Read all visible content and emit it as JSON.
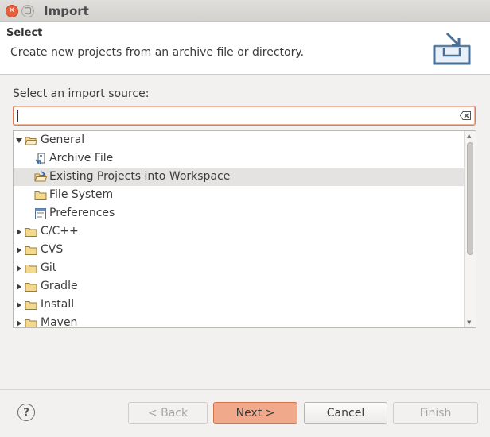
{
  "window": {
    "title": "Import"
  },
  "header": {
    "title": "Select",
    "description": "Create new projects from an archive file or directory.",
    "icon": "import-wizard-icon"
  },
  "source": {
    "label": "Select an import source:",
    "filter_value": "",
    "clear_icon": "clear-filter-icon"
  },
  "tree": {
    "items": [
      {
        "label": "General",
        "icon": "folder-open-icon",
        "expanded": true
      },
      {
        "label": "Archive File",
        "icon": "archive-file-icon"
      },
      {
        "label": "Existing Projects into Workspace",
        "icon": "project-folder-icon",
        "selected": true
      },
      {
        "label": "File System",
        "icon": "folder-icon"
      },
      {
        "label": "Preferences",
        "icon": "preferences-icon"
      },
      {
        "label": "C/C++",
        "icon": "folder-icon",
        "expanded": false
      },
      {
        "label": "CVS",
        "icon": "folder-icon",
        "expanded": false
      },
      {
        "label": "Git",
        "icon": "folder-icon",
        "expanded": false
      },
      {
        "label": "Gradle",
        "icon": "folder-icon",
        "expanded": false
      },
      {
        "label": "Install",
        "icon": "folder-icon",
        "expanded": false
      },
      {
        "label": "Maven",
        "icon": "folder-icon",
        "expanded": false
      }
    ]
  },
  "buttons": {
    "help_icon": "help-icon",
    "back": "< Back",
    "next": "Next >",
    "cancel": "Cancel",
    "finish": "Finish"
  },
  "colors": {
    "accent": "#e07a56",
    "primary_button": "#f0a98a",
    "selection": "#e4e3e1"
  }
}
